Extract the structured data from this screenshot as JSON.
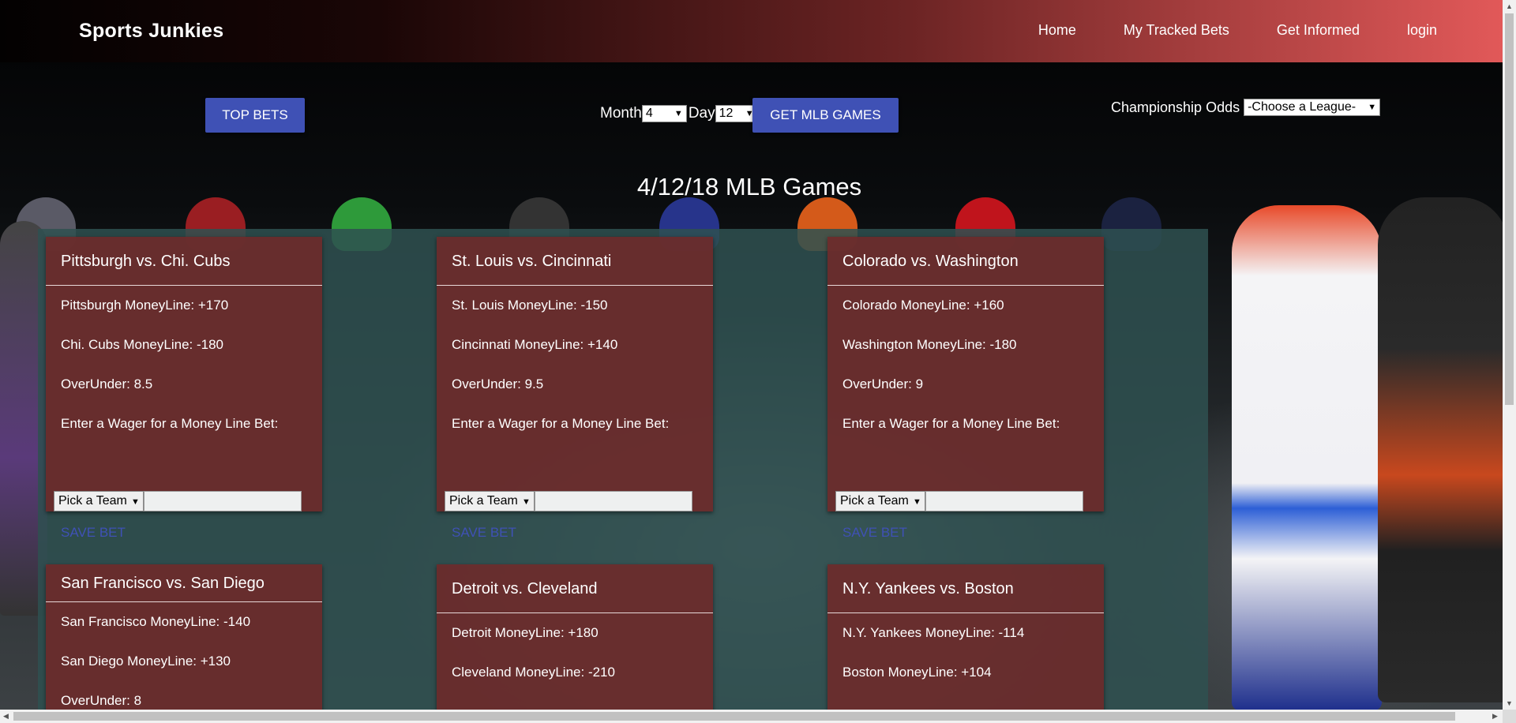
{
  "brand": "Sports Junkies",
  "nav": [
    "Home",
    "My Tracked Bets",
    "Get Informed",
    "login"
  ],
  "controls": {
    "top_bets": "TOP BETS",
    "month_label": "Month",
    "month_value": "4",
    "day_label": "Day",
    "day_value": "12",
    "get_games": "GET MLB GAMES",
    "champ_label": "Championship Odds",
    "champ_value": "-Choose a League-"
  },
  "games_title": "4/12/18 MLB Games",
  "games": [
    {
      "title": "Pittsburgh vs. Chi. Cubs",
      "lines": [
        "Pittsburgh MoneyLine:  +170",
        "Chi. Cubs MoneyLine:  -180",
        "OverUnder:  8.5",
        "Enter a Wager for a Money Line Bet:"
      ],
      "pick": "Pick a Team",
      "save": "SAVE BET"
    },
    {
      "title": "St. Louis vs. Cincinnati",
      "lines": [
        "St. Louis MoneyLine:  -150",
        "Cincinnati MoneyLine:  +140",
        "OverUnder:  9.5",
        "Enter a Wager for a Money Line Bet:"
      ],
      "pick": "Pick a Team",
      "save": "SAVE BET"
    },
    {
      "title": "Colorado vs. Washington",
      "lines": [
        "Colorado MoneyLine:  +160",
        "Washington MoneyLine:  -180",
        "OverUnder:  9",
        "Enter a Wager for a Money Line Bet:"
      ],
      "pick": "Pick a Team",
      "save": "SAVE BET"
    },
    {
      "title": "San Francisco vs. San Diego",
      "lines": [
        "San Francisco MoneyLine:  -140",
        "San Diego MoneyLine:  +130",
        "OverUnder:  8"
      ]
    },
    {
      "title": "Detroit vs. Cleveland",
      "lines": [
        "Detroit MoneyLine:  +180",
        "Cleveland MoneyLine:  -210"
      ]
    },
    {
      "title": "N.Y. Yankees vs. Boston",
      "lines": [
        "N.Y. Yankees MoneyLine:  -114",
        "Boston MoneyLine:  +104"
      ]
    }
  ],
  "colors": {
    "accent": "#3f51b5",
    "card": "#6e2a2a",
    "panel": "#2f5050"
  }
}
